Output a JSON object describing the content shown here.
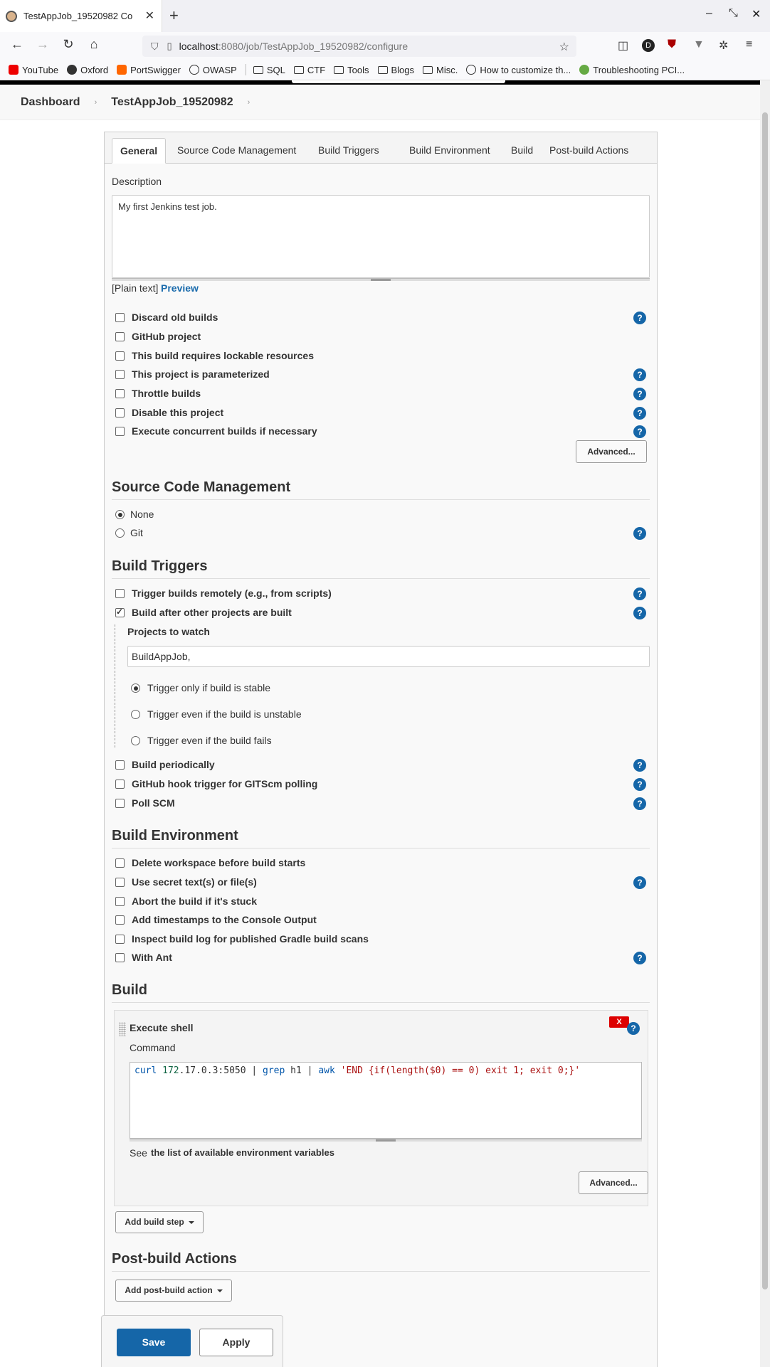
{
  "browser": {
    "tab_title": "TestAppJob_19520982 Co",
    "url_host": "localhost",
    "url_rest": ":8080/job/TestAppJob_19520982/configure",
    "bookmarks": [
      "YouTube",
      "Oxford",
      "PortSwigger",
      "OWASP",
      "SQL",
      "CTF",
      "Tools",
      "Blogs",
      "Misc.",
      "How to customize th...",
      "Troubleshooting PCI..."
    ]
  },
  "breadcrumb": {
    "dashboard": "Dashboard",
    "job": "TestAppJob_19520982"
  },
  "tabs": [
    "General",
    "Source Code Management",
    "Build Triggers",
    "Build Environment",
    "Build",
    "Post-build Actions"
  ],
  "general": {
    "description_label": "Description",
    "description_value": "My first Jenkins test job.",
    "plain_text": "[Plain text]",
    "preview": "Preview",
    "options": [
      "Discard old builds",
      "GitHub project",
      "This build requires lockable resources",
      "This project is parameterized",
      "Throttle builds",
      "Disable this project",
      "Execute concurrent builds if necessary"
    ],
    "advanced": "Advanced..."
  },
  "scm": {
    "title": "Source Code Management",
    "none": "None",
    "git": "Git"
  },
  "triggers": {
    "title": "Build Triggers",
    "remote": "Trigger builds remotely (e.g., from scripts)",
    "after_other": "Build after other projects are built",
    "projects_label": "Projects to watch",
    "projects_value": "BuildAppJob,",
    "stable": "Trigger only if build is stable",
    "unstable": "Trigger even if the build is unstable",
    "fails": "Trigger even if the build fails",
    "periodic": "Build periodically",
    "github_hook": "GitHub hook trigger for GITScm polling",
    "poll_scm": "Poll SCM"
  },
  "environment": {
    "title": "Build Environment",
    "options": [
      "Delete workspace before build starts",
      "Use secret text(s) or file(s)",
      "Abort the build if it's stuck",
      "Add timestamps to the Console Output",
      "Inspect build log for published Gradle build scans",
      "With Ant"
    ]
  },
  "build": {
    "title": "Build",
    "step_title": "Execute shell",
    "delete": "X",
    "command_label": "Command",
    "cmd_curl": "curl",
    "cmd_ip": "172",
    "cmd_ip_rest": ".17.0.3:5050 | ",
    "cmd_grep": "grep",
    "cmd_mid": " h1 | ",
    "cmd_awk": "awk",
    "cmd_str": " 'END {if(length($0) == 0) exit 1; exit 0;}'",
    "see": "See ",
    "env_link": "the list of available environment variables",
    "advanced": "Advanced...",
    "add_step": "Add build step"
  },
  "post_build": {
    "title": "Post-build Actions",
    "add_action": "Add post-build action"
  },
  "footer": {
    "save": "Save",
    "apply": "Apply"
  },
  "help_glyph": "?"
}
